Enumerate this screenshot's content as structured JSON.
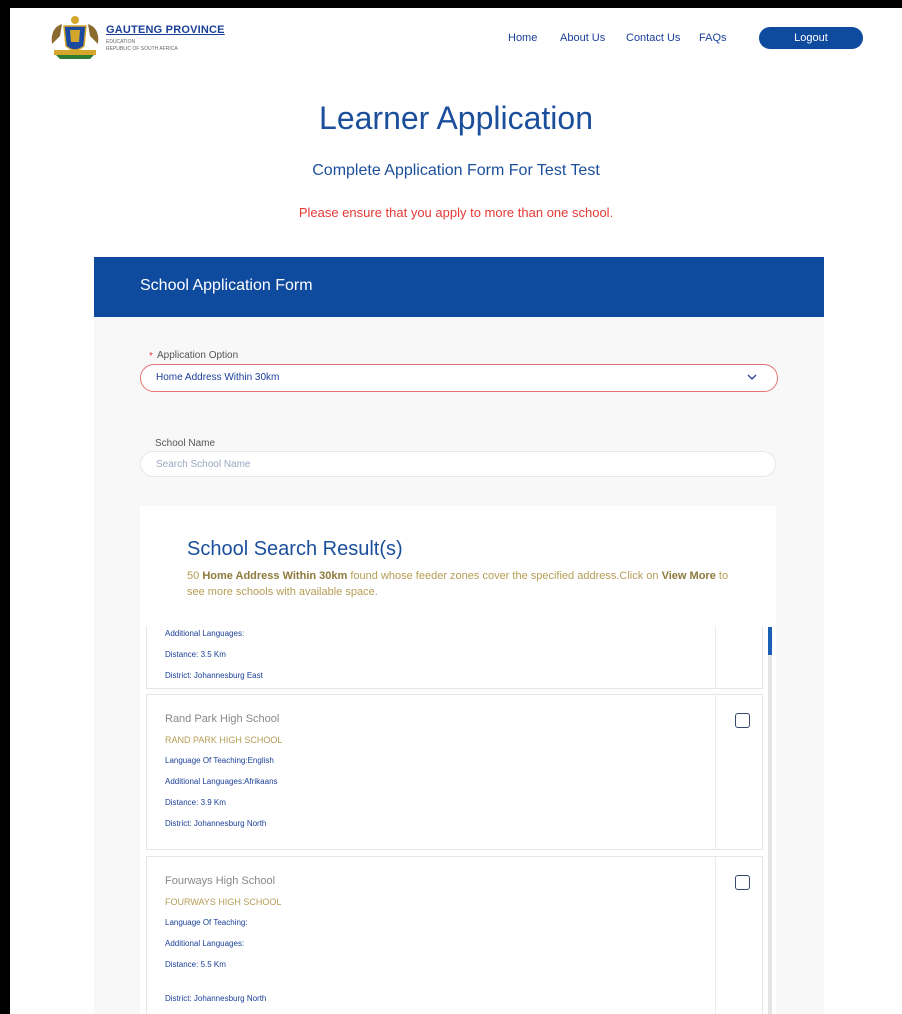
{
  "header": {
    "logo_title": "GAUTENG PROVINCE",
    "logo_sub1": "EDUCATION",
    "logo_sub2": "REPUBLIC OF SOUTH AFRICA",
    "logo_icon": "coat-of-arms-icon",
    "nav": [
      "Home",
      "About Us",
      "Contact Us",
      "FAQs"
    ],
    "logout_label": "Logout"
  },
  "page": {
    "title": "Learner Application",
    "subtitle": "Complete Application Form For Test Test",
    "warning": "Please ensure that you apply to more than one school."
  },
  "form": {
    "header": "School Application Form",
    "application_option_label": "Application Option",
    "required_marker": "*",
    "application_option_value": "Home Address Within 30km",
    "school_name_label": "School Name",
    "school_name_placeholder": "Search School Name"
  },
  "results": {
    "title": "School Search Result(s)",
    "desc_count": "50",
    "desc_option": "Home Address Within 30km",
    "desc_middle": "found whose feeder zones cover the specified address.Click on",
    "desc_link": "View More",
    "desc_end": "to see more schools with available space.",
    "partial_card": {
      "additional_languages": "Additional Languages:",
      "distance": "Distance: 3.5 Km",
      "district": "District: Johannesburg East"
    },
    "schools": [
      {
        "name": "Rand Park High School",
        "code_name": "RAND PARK HIGH SCHOOL",
        "language": "Language Of Teaching:English",
        "additional_languages": "Additional Languages:Afrikaans",
        "distance": "Distance: 3.9 Km",
        "district": "District: Johannesburg North"
      },
      {
        "name": "Fourways High School",
        "code_name": "FOURWAYS HIGH SCHOOL",
        "language": "Language Of Teaching:",
        "additional_languages": "Additional Languages:",
        "distance": "Distance: 5.5 Km",
        "district": "District: Johannesburg North"
      }
    ]
  },
  "colors": {
    "brand_blue": "#0e4a9e",
    "title_blue": "#1b4f9c",
    "warning_red": "#e53935",
    "gold": "#b59d55"
  }
}
